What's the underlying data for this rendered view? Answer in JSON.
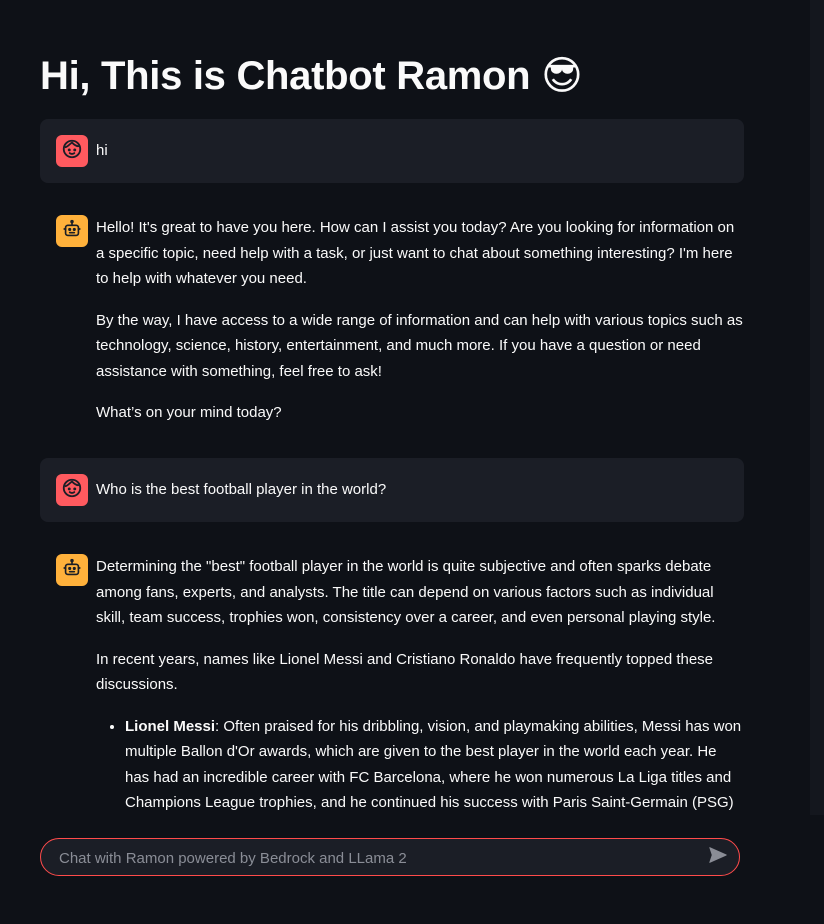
{
  "title": "Hi, This is Chatbot Ramon 😎",
  "messages": [
    {
      "role": "user",
      "avatar_icon": "user-face-icon",
      "paragraphs": [
        "hi"
      ]
    },
    {
      "role": "assistant",
      "avatar_icon": "robot-icon",
      "paragraphs": [
        "Hello! It's great to have you here. How can I assist you today? Are you looking for information on a specific topic, need help with a task, or just want to chat about something interesting? I'm here to help with whatever you need.",
        "By the way, I have access to a wide range of information and can help with various topics such as technology, science, history, entertainment, and much more. If you have a question or need assistance with something, feel free to ask!",
        "What’s on your mind today?"
      ]
    },
    {
      "role": "user",
      "avatar_icon": "user-face-icon",
      "paragraphs": [
        "Who is the best football player in the world?"
      ]
    },
    {
      "role": "assistant",
      "avatar_icon": "robot-icon",
      "paragraphs": [
        "Determining the \"best\" football player in the world is quite subjective and often sparks debate among fans, experts, and analysts. The title can depend on various factors such as individual skill, team success, trophies won, consistency over a career, and even personal playing style.",
        "In recent years, names like Lionel Messi and Cristiano Ronaldo have frequently topped these discussions."
      ],
      "bullets": [
        {
          "bold": "Lionel Messi",
          "text": ": Often praised for his dribbling, vision, and playmaking abilities, Messi has won multiple Ballon d'Or awards, which are given to the best player in the world each year. He has had an incredible career with FC Barcelona, where he won numerous La Liga titles and Champions League trophies, and he continued his success with Paris Saint-Germain (PSG) and later Inter Miami CF."
        }
      ]
    }
  ],
  "chat_input": {
    "placeholder": "Chat with Ramon powered by Bedrock and LLama 2",
    "value": ""
  },
  "colors": {
    "background": "#0e1117",
    "user_bubble": "#1b1e26",
    "user_avatar": "#ff5a5f",
    "bot_avatar": "#ffb13b",
    "input_border": "#ff4b4b"
  }
}
